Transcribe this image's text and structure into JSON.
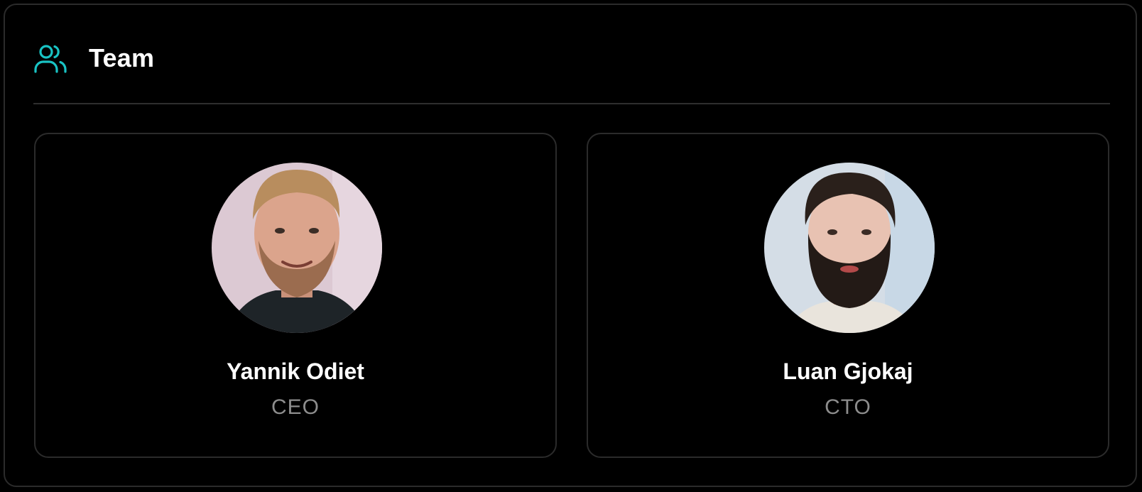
{
  "header": {
    "icon": "users-icon",
    "title": "Team",
    "accent_color": "#19c3c4"
  },
  "members": [
    {
      "name": "Yannik Odiet",
      "role": "CEO",
      "avatar": "portrait-photo"
    },
    {
      "name": "Luan Gjokaj",
      "role": "CTO",
      "avatar": "portrait-photo"
    }
  ]
}
